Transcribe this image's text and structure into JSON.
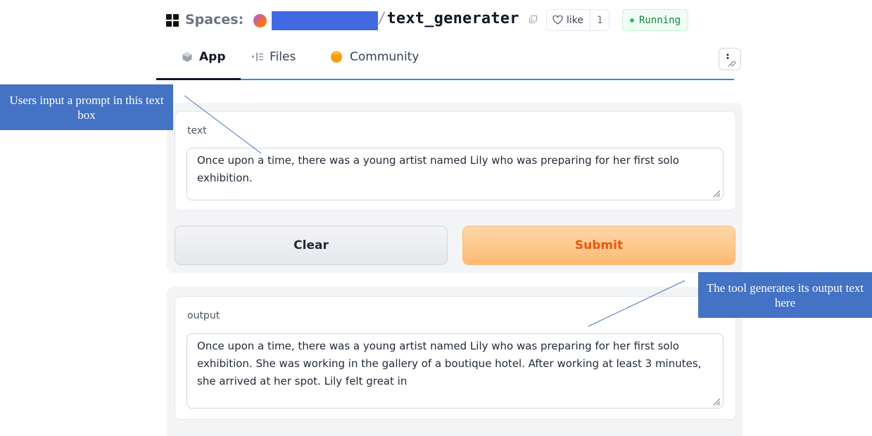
{
  "header": {
    "spaces_label": "Spaces:",
    "repo_slash": "/",
    "repo_name": "text_generater",
    "like_label": "like",
    "like_count": "1",
    "status": "Running",
    "status_color": "#22c55e"
  },
  "tabs": [
    {
      "label": "App",
      "icon": "cube-icon",
      "active": true
    },
    {
      "label": "Files",
      "icon": "files-icon",
      "active": false
    },
    {
      "label": "Community",
      "icon": "community-icon",
      "active": false
    }
  ],
  "input": {
    "label": "text",
    "value": "Once upon a time, there was a young artist named Lily who was preparing for her first solo exhibition."
  },
  "buttons": {
    "clear": "Clear",
    "submit": "Submit",
    "submit_color": "#ea580c"
  },
  "output": {
    "label": "output",
    "value": "Once upon a time, there was a young artist named Lily who was preparing for her first solo exhibition. She was working in the gallery of a boutique hotel. After working at least 3 minutes, she arrived at her spot. Lily felt great in"
  },
  "annotations": {
    "left": "Users input a prompt in this text box",
    "right": "The tool generates its output text here",
    "callout_color": "#4472c4"
  }
}
